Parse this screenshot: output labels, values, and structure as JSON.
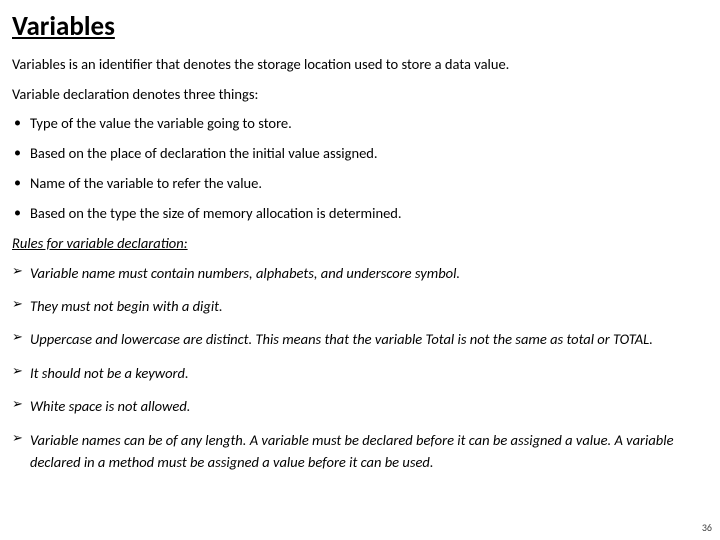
{
  "title": "Variables",
  "intro1": "Variables is an identifier that denotes the storage location used to store a data value.",
  "intro2": "Variable declaration denotes three things:",
  "bullets": [
    "Type of the value  the variable going to store.",
    "Based on the place of declaration the initial value assigned.",
    "Name of the variable to refer the value.",
    "Based on the type the size of memory allocation is determined."
  ],
  "rules_heading": "Rules for variable declaration:",
  "rules": [
    "Variable name must contain numbers, alphabets, and  underscore symbol.",
    "They must not begin with a digit.",
    "Uppercase and lowercase are distinct. This means that the variable Total is not the same as total or TOTAL.",
    "It should not be a keyword.",
    "White space is not allowed.",
    "Variable names can be of any length. A variable must be declared before it can be assigned a value. A variable declared in a method must be assigned a value before it can be used."
  ],
  "page_number": "36"
}
